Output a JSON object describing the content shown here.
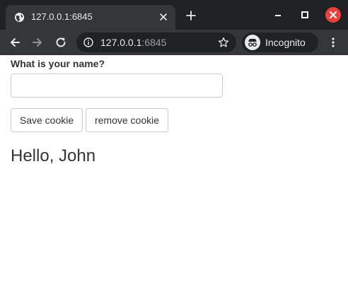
{
  "browser": {
    "tab": {
      "title": "127.0.0.1:6845"
    },
    "address": {
      "host": "127.0.0.1",
      "port": ":6845"
    },
    "profile": {
      "label": "Incognito"
    },
    "colors": {
      "frame": "#202124",
      "toolbar": "#35363a",
      "close": "#e8413c"
    }
  },
  "page": {
    "question_label": "What is your name?",
    "name_input": {
      "value": "",
      "placeholder": ""
    },
    "buttons": {
      "save": "Save cookie",
      "remove": "remove cookie"
    },
    "greeting": "Hello, John"
  }
}
